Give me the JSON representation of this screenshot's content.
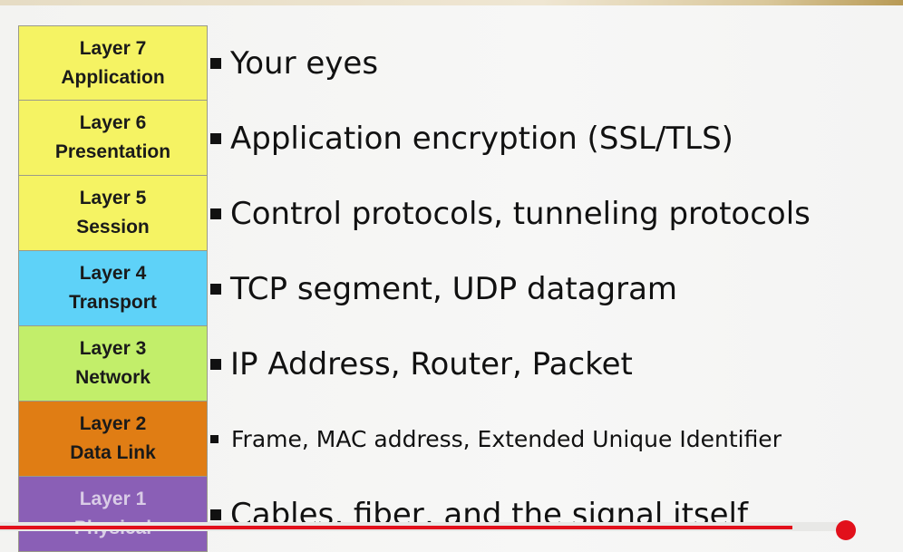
{
  "layers": [
    {
      "number": "Layer 7",
      "name": "Application",
      "color": "#f5f363",
      "text_color": "#1a1a1a",
      "description": "Your eyes",
      "size": 34
    },
    {
      "number": "Layer 6",
      "name": "Presentation",
      "color": "#f5f363",
      "text_color": "#1a1a1a",
      "description": "Application encryption (SSL/TLS)",
      "size": 34
    },
    {
      "number": "Layer 5",
      "name": "Session",
      "color": "#f5f363",
      "text_color": "#1a1a1a",
      "description": "Control protocols, tunneling protocols",
      "size": 34
    },
    {
      "number": "Layer 4",
      "name": "Transport",
      "color": "#5ed2f8",
      "text_color": "#1a1a1a",
      "description": "TCP segment, UDP datagram",
      "size": 34
    },
    {
      "number": "Layer 3",
      "name": "Network",
      "color": "#c2ee6a",
      "text_color": "#1a1a1a",
      "description": "IP Address, Router, Packet",
      "size": 34
    },
    {
      "number": "Layer 2",
      "name": "Data Link",
      "color": "#e07d14",
      "text_color": "#1a1a1a",
      "description": "Frame, MAC address, Extended Unique Identifier",
      "size": 25
    },
    {
      "number": "Layer 1",
      "name": "Physical",
      "color": "#8a5fb6",
      "text_color": "#d9cce6",
      "description": "Cables, fiber, and the signal itself",
      "size": 34
    }
  ],
  "player": {
    "progress_fraction": 0.93,
    "accent": "#e2101b"
  }
}
